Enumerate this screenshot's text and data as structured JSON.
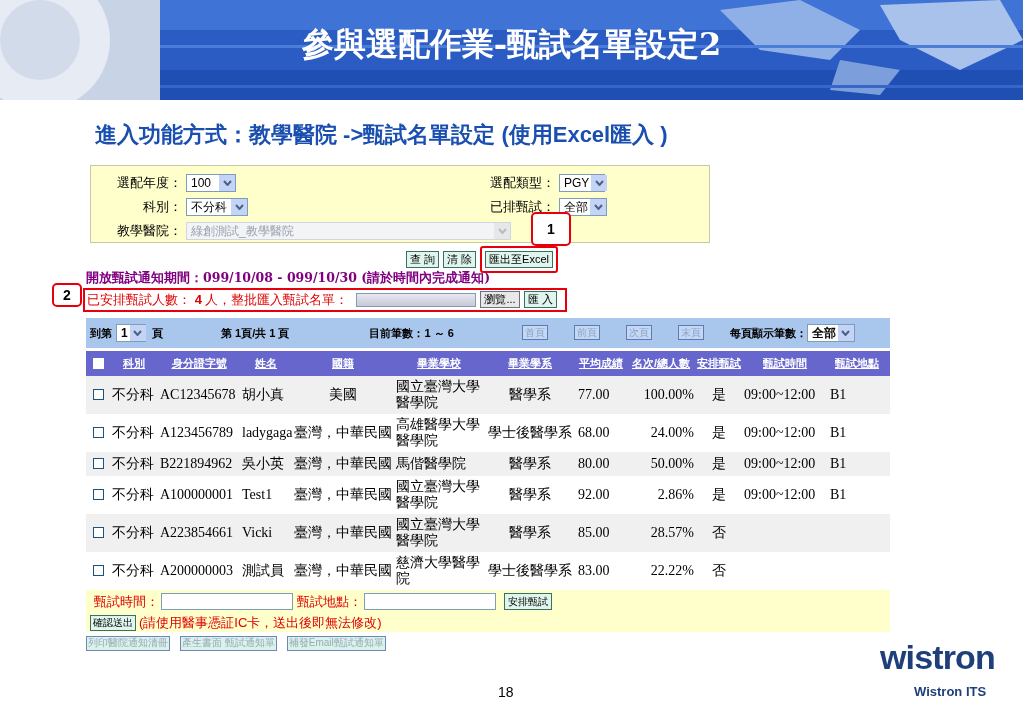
{
  "slide": {
    "title": "參與選配作業-甄試名單設定2",
    "subtitle": "進入功能方式：教學醫院 ->甄試名單設定 (使用Excel匯入 )",
    "page_number": "18"
  },
  "logo": {
    "wordmark": "wistron",
    "tagline": "Wistron ITS"
  },
  "filters": {
    "left": [
      {
        "label": "選配年度：",
        "value": "100",
        "disabled": false
      },
      {
        "label": "科別：",
        "value": "不分科",
        "disabled": false
      },
      {
        "label": "教學醫院：",
        "value": "綠創測試_教學醫院",
        "disabled": true
      }
    ],
    "right": [
      {
        "label": "選配類型：",
        "value": "PGY",
        "disabled": false
      },
      {
        "label": "已排甄試：",
        "value": "全部",
        "disabled": false
      }
    ]
  },
  "actions": [
    {
      "label": "查 詢",
      "highlighted": false
    },
    {
      "label": "清 除",
      "highlighted": false
    },
    {
      "label": "匯出至Excel",
      "highlighted": true
    }
  ],
  "callouts": [
    {
      "number": "1"
    },
    {
      "number": "2"
    }
  ],
  "notice": "開放甄試通知期間：099/10/08 - 099/10/30 (請於時間內完成通知)",
  "import": {
    "label": "已安排甄試人數： **4** 人，整批匯入甄試名單：",
    "browse": "瀏覽...",
    "submit": "匯 入"
  },
  "paging": {
    "goto_prefix": "到第",
    "page": "1",
    "goto_suffix": "頁",
    "page_info": "第 1頁/共 1 頁",
    "count": "目前筆數：1 ～ 6",
    "nav": [
      {
        "label": "首頁",
        "disabled": true
      },
      {
        "label": "前頁",
        "disabled": true
      },
      {
        "label": "次頁",
        "disabled": true
      },
      {
        "label": "末頁",
        "disabled": true
      }
    ],
    "per_page_label": "每頁顯示筆數：",
    "per_page": "全部"
  },
  "table": {
    "select_all": false,
    "columns": [
      "科別",
      "身分證字號",
      "姓名",
      "國籍",
      "畢業學校",
      "畢業學系",
      "平均成績",
      "名次/總人數",
      "安排甄試",
      "甄試時間",
      "甄試地點"
    ],
    "rows": [
      {
        "checked": false,
        "cells": [
          "不分科",
          "AC12345678",
          "胡小真",
          "美國",
          "國立臺灣大學醫學院",
          "醫學系",
          "77.00",
          "100.00%",
          "是",
          "09:00~12:00",
          "B1"
        ]
      },
      {
        "checked": false,
        "cells": [
          "不分科",
          "A123456789",
          "ladygaga",
          "臺灣，中華民國",
          "高雄醫學大學醫學院",
          "學士後醫學系",
          "68.00",
          "24.00%",
          "是",
          "09:00~12:00",
          "B1"
        ]
      },
      {
        "checked": false,
        "cells": [
          "不分科",
          "B221894962",
          "吳小英",
          "臺灣，中華民國",
          "馬偕醫學院",
          "醫學系",
          "80.00",
          "50.00%",
          "是",
          "09:00~12:00",
          "B1"
        ]
      },
      {
        "checked": false,
        "cells": [
          "不分科",
          "A100000001",
          "Test1",
          "臺灣，中華民國",
          "國立臺灣大學醫學院",
          "醫學系",
          "92.00",
          "2.86%",
          "是",
          "09:00~12:00",
          "B1"
        ]
      },
      {
        "checked": false,
        "cells": [
          "不分科",
          "A223854661",
          "Vicki",
          "臺灣，中華民國",
          "國立臺灣大學醫學院",
          "醫學系",
          "85.00",
          "28.57%",
          "否",
          "",
          ""
        ]
      },
      {
        "checked": false,
        "cells": [
          "不分科",
          "A200000003",
          "測試員",
          "臺灣，中華民國",
          "慈濟大學醫學院",
          "學士後醫學系",
          "83.00",
          "22.22%",
          "否",
          "",
          ""
        ]
      }
    ]
  },
  "schedule": {
    "time_label": "甄試時間：",
    "place_label": "甄試地點：",
    "arrange": "安排甄試",
    "submit": "確認送出",
    "warning": "(請使用醫事憑証IC卡，送出後即無法修改)"
  },
  "extra_buttons": [
    {
      "label": "列印醫院通知清冊",
      "disabled": true
    },
    {
      "label": "產生書面 甄試通知單",
      "disabled": true
    },
    {
      "label": "補發Email甄試通知單",
      "disabled": true
    }
  ]
}
